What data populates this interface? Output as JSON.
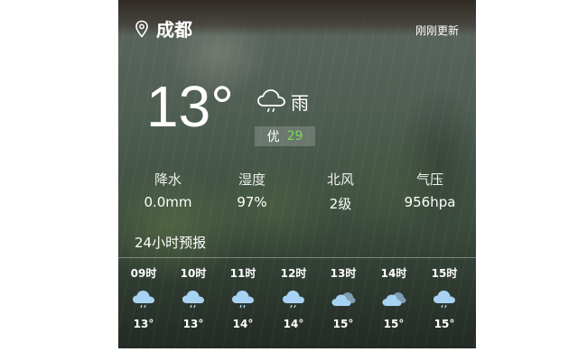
{
  "header": {
    "city": "成都",
    "updated": "刚刚更新",
    "location_icon": "location-pin-icon"
  },
  "current": {
    "temperature": "13°",
    "condition": "雨",
    "condition_icon": "cloud-rain-icon",
    "aqi_label": "优",
    "aqi_value": "29"
  },
  "stats": [
    {
      "label": "降水",
      "value": "0.0mm"
    },
    {
      "label": "湿度",
      "value": "97%"
    },
    {
      "label": "北风",
      "value": "2级"
    },
    {
      "label": "气压",
      "value": "956hpa"
    }
  ],
  "forecast": {
    "title": "24小时预报",
    "hours": [
      {
        "time": "09时",
        "icon": "cloud-rain-icon",
        "temp": "13°"
      },
      {
        "time": "10时",
        "icon": "cloud-rain-icon",
        "temp": "13°"
      },
      {
        "time": "11时",
        "icon": "cloud-rain-icon",
        "temp": "14°"
      },
      {
        "time": "12时",
        "icon": "cloud-rain-icon",
        "temp": "14°"
      },
      {
        "time": "13时",
        "icon": "overcast-cloud-icon",
        "temp": "15°"
      },
      {
        "time": "14时",
        "icon": "overcast-cloud-icon",
        "temp": "15°"
      },
      {
        "time": "15时",
        "icon": "cloud-rain-icon",
        "temp": "15°"
      }
    ]
  },
  "colors": {
    "aqi_good": "#7ed957",
    "icon_cloud": "#a8d2f2"
  }
}
